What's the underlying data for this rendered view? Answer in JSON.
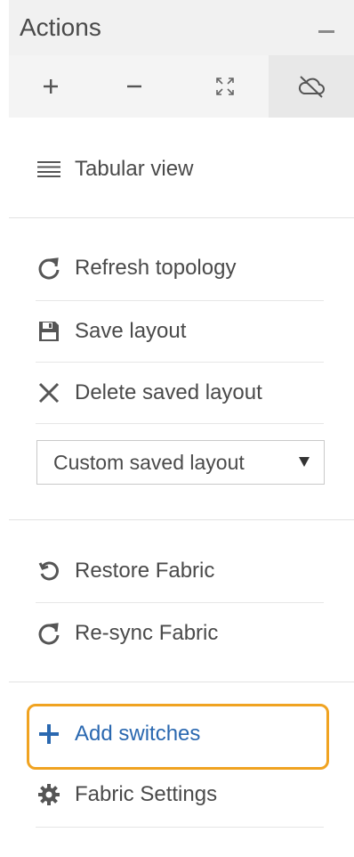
{
  "header": {
    "title": "Actions"
  },
  "toolbar": {
    "buttons": [
      {
        "icon": "plus-icon"
      },
      {
        "icon": "minus-icon"
      },
      {
        "icon": "fit-to-screen-icon"
      },
      {
        "icon": "cloud-off-icon"
      }
    ]
  },
  "view_section": {
    "tabular_view_label": "Tabular view"
  },
  "layout_section": {
    "refresh_topology_label": "Refresh topology",
    "save_layout_label": "Save layout",
    "delete_saved_layout_label": "Delete saved layout",
    "layout_select_value": "Custom saved layout"
  },
  "fabric_section": {
    "restore_fabric_label": "Restore Fabric",
    "resync_fabric_label": "Re-sync Fabric"
  },
  "switch_section": {
    "add_switches_label": "Add switches",
    "fabric_settings_label": "Fabric Settings"
  },
  "colors": {
    "accent_blue": "#2a68b0",
    "highlight_orange": "#f0a321",
    "header_bg": "#f1f1f1"
  }
}
